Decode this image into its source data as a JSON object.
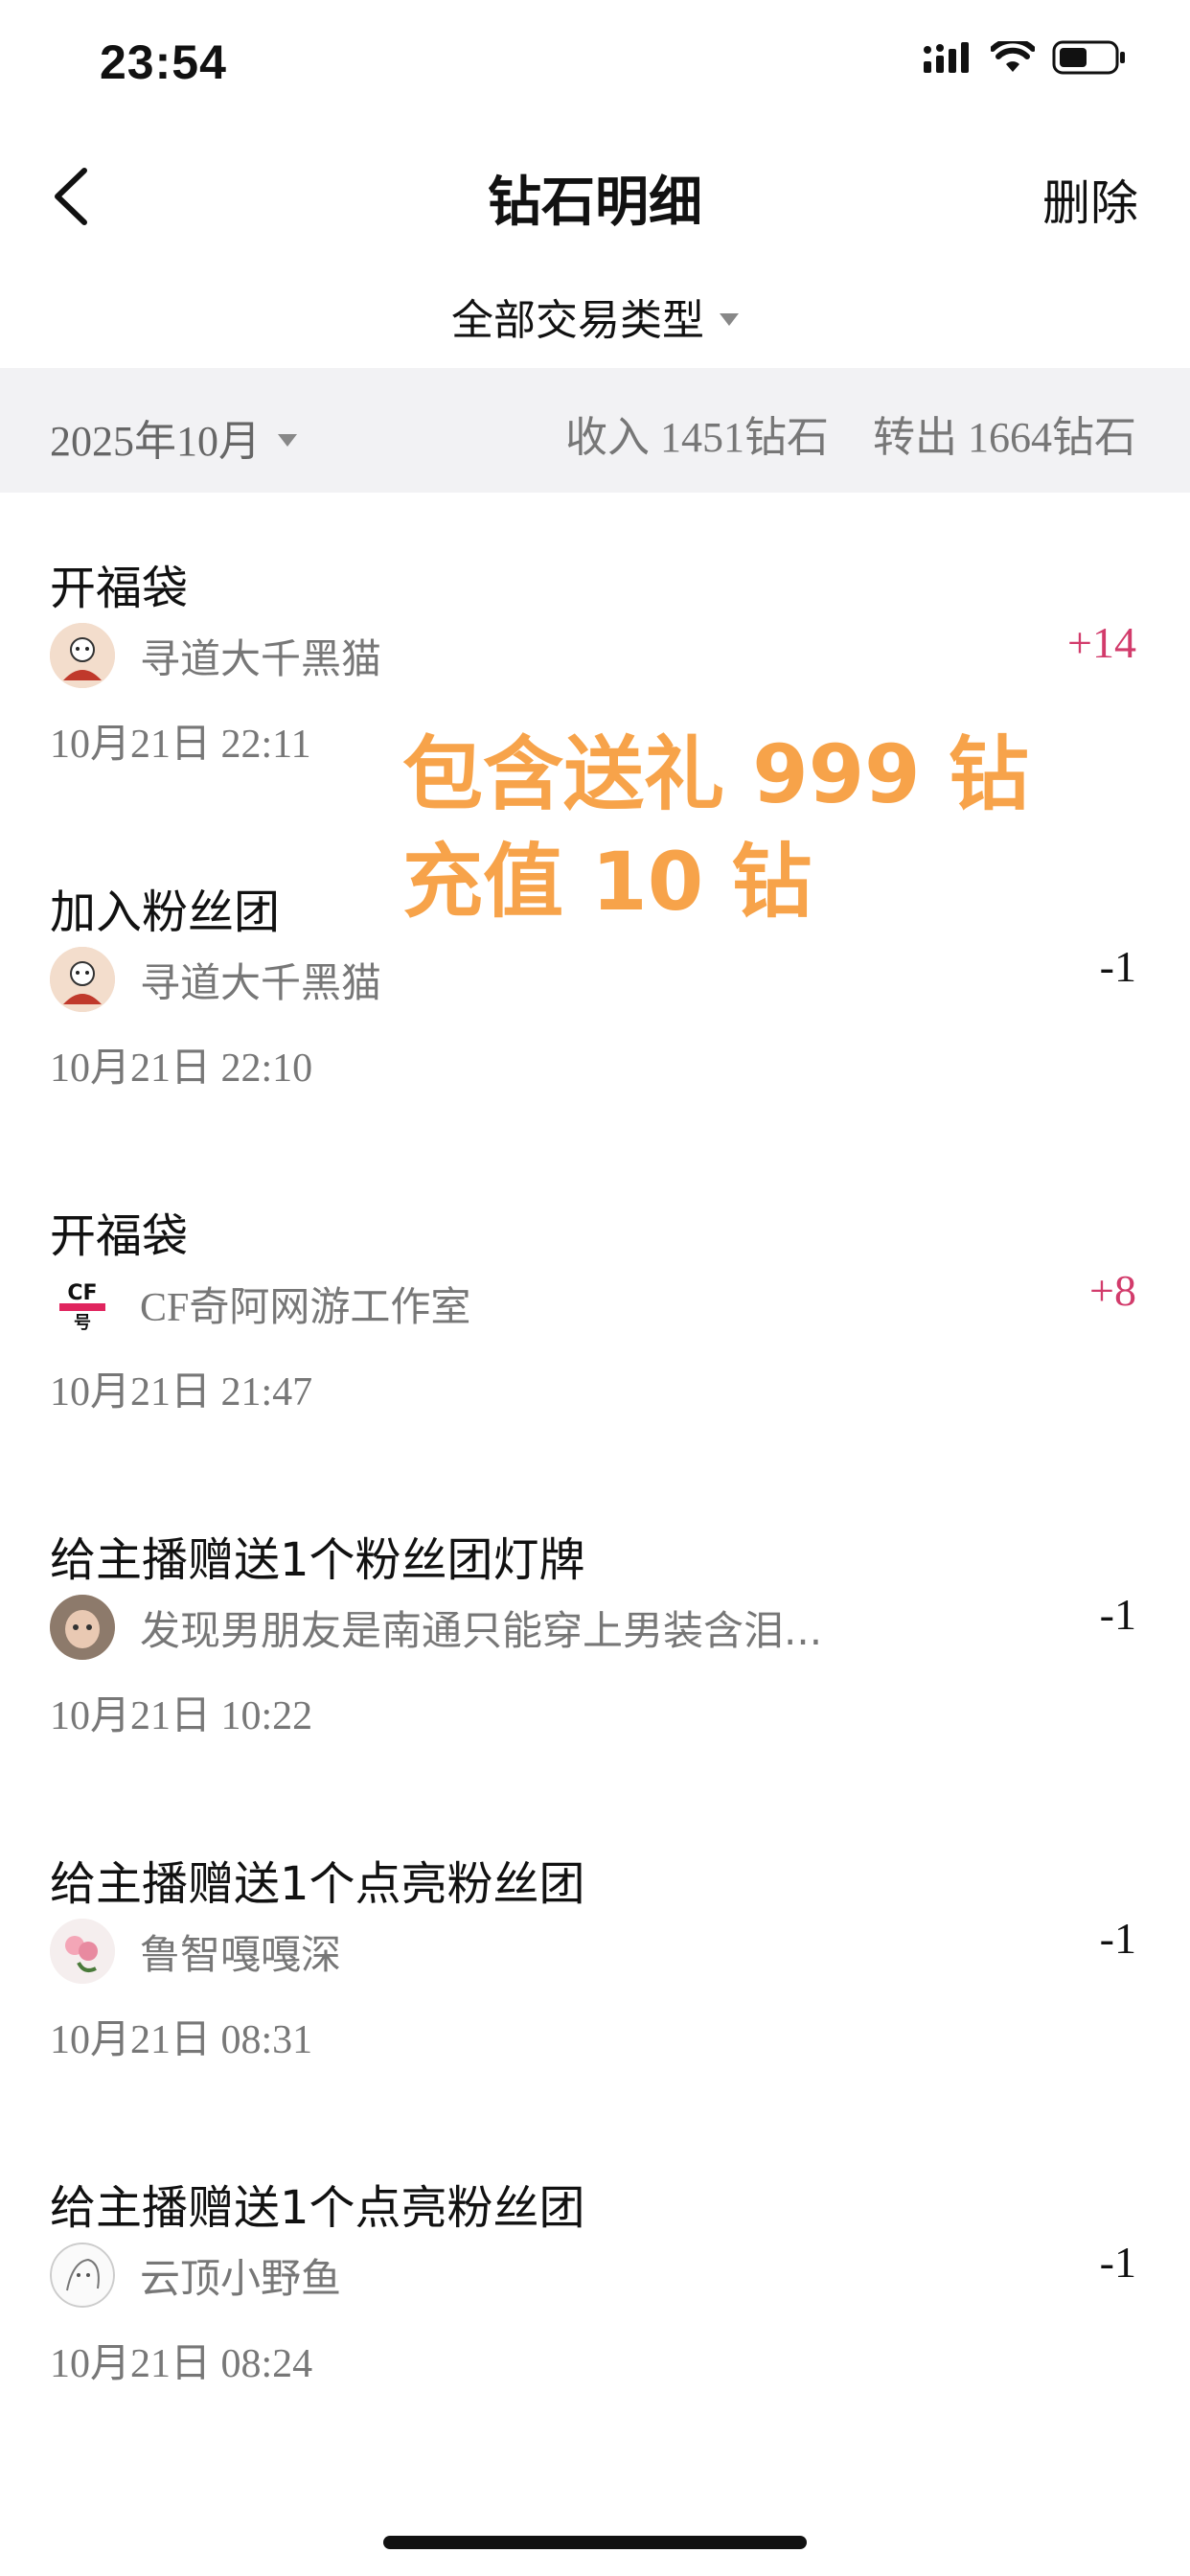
{
  "status_bar": {
    "time": "23:54"
  },
  "nav": {
    "title": "钻石明细",
    "delete_label": "删除"
  },
  "filter": {
    "label": "全部交易类型"
  },
  "summary": {
    "month": "2025年10月",
    "income": "收入 1451钻石",
    "transfer_out": "转出 1664钻石"
  },
  "annotation": {
    "line1": "包含送礼 999 钻",
    "line2": "充值 10 钻"
  },
  "transactions": [
    {
      "title": "开福袋",
      "user": "寻道大千黑猫",
      "amount": "+14",
      "date": "10月21日 22:11",
      "positive": true
    },
    {
      "title": "加入粉丝团",
      "user": "寻道大千黑猫",
      "amount": "-1",
      "date": "10月21日 22:10",
      "positive": false
    },
    {
      "title": "开福袋",
      "user": "CF奇阿网游工作室",
      "amount": "+8",
      "date": "10月21日 21:47",
      "positive": true
    },
    {
      "title": "给主播赠送1个粉丝团灯牌",
      "user": "发现男朋友是南通只能穿上男装含泪...",
      "amount": "-1",
      "date": "10月21日 10:22",
      "positive": false
    },
    {
      "title": "给主播赠送1个点亮粉丝团",
      "user": "鲁智嘎嘎深",
      "amount": "-1",
      "date": "10月21日 08:31",
      "positive": false
    },
    {
      "title": "给主播赠送1个点亮粉丝团",
      "user": "云顶小野鱼",
      "amount": "-1",
      "date": "10月21日 08:24",
      "positive": false
    }
  ],
  "colors": {
    "positive": "#d23b6b",
    "annotation": "#f7a34a",
    "summary_bg": "#f2f2f4"
  }
}
